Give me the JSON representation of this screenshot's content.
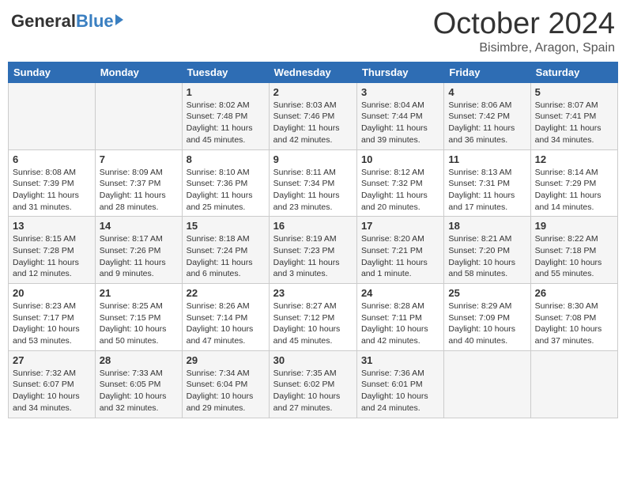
{
  "header": {
    "logo_general": "General",
    "logo_blue": "Blue",
    "title": "October 2024",
    "subtitle": "Bisimbre, Aragon, Spain"
  },
  "weekdays": [
    "Sunday",
    "Monday",
    "Tuesday",
    "Wednesday",
    "Thursday",
    "Friday",
    "Saturday"
  ],
  "weeks": [
    [
      {
        "day": "",
        "sunrise": "",
        "sunset": "",
        "daylight": ""
      },
      {
        "day": "",
        "sunrise": "",
        "sunset": "",
        "daylight": ""
      },
      {
        "day": "1",
        "sunrise": "Sunrise: 8:02 AM",
        "sunset": "Sunset: 7:48 PM",
        "daylight": "Daylight: 11 hours and 45 minutes."
      },
      {
        "day": "2",
        "sunrise": "Sunrise: 8:03 AM",
        "sunset": "Sunset: 7:46 PM",
        "daylight": "Daylight: 11 hours and 42 minutes."
      },
      {
        "day": "3",
        "sunrise": "Sunrise: 8:04 AM",
        "sunset": "Sunset: 7:44 PM",
        "daylight": "Daylight: 11 hours and 39 minutes."
      },
      {
        "day": "4",
        "sunrise": "Sunrise: 8:06 AM",
        "sunset": "Sunset: 7:42 PM",
        "daylight": "Daylight: 11 hours and 36 minutes."
      },
      {
        "day": "5",
        "sunrise": "Sunrise: 8:07 AM",
        "sunset": "Sunset: 7:41 PM",
        "daylight": "Daylight: 11 hours and 34 minutes."
      }
    ],
    [
      {
        "day": "6",
        "sunrise": "Sunrise: 8:08 AM",
        "sunset": "Sunset: 7:39 PM",
        "daylight": "Daylight: 11 hours and 31 minutes."
      },
      {
        "day": "7",
        "sunrise": "Sunrise: 8:09 AM",
        "sunset": "Sunset: 7:37 PM",
        "daylight": "Daylight: 11 hours and 28 minutes."
      },
      {
        "day": "8",
        "sunrise": "Sunrise: 8:10 AM",
        "sunset": "Sunset: 7:36 PM",
        "daylight": "Daylight: 11 hours and 25 minutes."
      },
      {
        "day": "9",
        "sunrise": "Sunrise: 8:11 AM",
        "sunset": "Sunset: 7:34 PM",
        "daylight": "Daylight: 11 hours and 23 minutes."
      },
      {
        "day": "10",
        "sunrise": "Sunrise: 8:12 AM",
        "sunset": "Sunset: 7:32 PM",
        "daylight": "Daylight: 11 hours and 20 minutes."
      },
      {
        "day": "11",
        "sunrise": "Sunrise: 8:13 AM",
        "sunset": "Sunset: 7:31 PM",
        "daylight": "Daylight: 11 hours and 17 minutes."
      },
      {
        "day": "12",
        "sunrise": "Sunrise: 8:14 AM",
        "sunset": "Sunset: 7:29 PM",
        "daylight": "Daylight: 11 hours and 14 minutes."
      }
    ],
    [
      {
        "day": "13",
        "sunrise": "Sunrise: 8:15 AM",
        "sunset": "Sunset: 7:28 PM",
        "daylight": "Daylight: 11 hours and 12 minutes."
      },
      {
        "day": "14",
        "sunrise": "Sunrise: 8:17 AM",
        "sunset": "Sunset: 7:26 PM",
        "daylight": "Daylight: 11 hours and 9 minutes."
      },
      {
        "day": "15",
        "sunrise": "Sunrise: 8:18 AM",
        "sunset": "Sunset: 7:24 PM",
        "daylight": "Daylight: 11 hours and 6 minutes."
      },
      {
        "day": "16",
        "sunrise": "Sunrise: 8:19 AM",
        "sunset": "Sunset: 7:23 PM",
        "daylight": "Daylight: 11 hours and 3 minutes."
      },
      {
        "day": "17",
        "sunrise": "Sunrise: 8:20 AM",
        "sunset": "Sunset: 7:21 PM",
        "daylight": "Daylight: 11 hours and 1 minute."
      },
      {
        "day": "18",
        "sunrise": "Sunrise: 8:21 AM",
        "sunset": "Sunset: 7:20 PM",
        "daylight": "Daylight: 10 hours and 58 minutes."
      },
      {
        "day": "19",
        "sunrise": "Sunrise: 8:22 AM",
        "sunset": "Sunset: 7:18 PM",
        "daylight": "Daylight: 10 hours and 55 minutes."
      }
    ],
    [
      {
        "day": "20",
        "sunrise": "Sunrise: 8:23 AM",
        "sunset": "Sunset: 7:17 PM",
        "daylight": "Daylight: 10 hours and 53 minutes."
      },
      {
        "day": "21",
        "sunrise": "Sunrise: 8:25 AM",
        "sunset": "Sunset: 7:15 PM",
        "daylight": "Daylight: 10 hours and 50 minutes."
      },
      {
        "day": "22",
        "sunrise": "Sunrise: 8:26 AM",
        "sunset": "Sunset: 7:14 PM",
        "daylight": "Daylight: 10 hours and 47 minutes."
      },
      {
        "day": "23",
        "sunrise": "Sunrise: 8:27 AM",
        "sunset": "Sunset: 7:12 PM",
        "daylight": "Daylight: 10 hours and 45 minutes."
      },
      {
        "day": "24",
        "sunrise": "Sunrise: 8:28 AM",
        "sunset": "Sunset: 7:11 PM",
        "daylight": "Daylight: 10 hours and 42 minutes."
      },
      {
        "day": "25",
        "sunrise": "Sunrise: 8:29 AM",
        "sunset": "Sunset: 7:09 PM",
        "daylight": "Daylight: 10 hours and 40 minutes."
      },
      {
        "day": "26",
        "sunrise": "Sunrise: 8:30 AM",
        "sunset": "Sunset: 7:08 PM",
        "daylight": "Daylight: 10 hours and 37 minutes."
      }
    ],
    [
      {
        "day": "27",
        "sunrise": "Sunrise: 7:32 AM",
        "sunset": "Sunset: 6:07 PM",
        "daylight": "Daylight: 10 hours and 34 minutes."
      },
      {
        "day": "28",
        "sunrise": "Sunrise: 7:33 AM",
        "sunset": "Sunset: 6:05 PM",
        "daylight": "Daylight: 10 hours and 32 minutes."
      },
      {
        "day": "29",
        "sunrise": "Sunrise: 7:34 AM",
        "sunset": "Sunset: 6:04 PM",
        "daylight": "Daylight: 10 hours and 29 minutes."
      },
      {
        "day": "30",
        "sunrise": "Sunrise: 7:35 AM",
        "sunset": "Sunset: 6:02 PM",
        "daylight": "Daylight: 10 hours and 27 minutes."
      },
      {
        "day": "31",
        "sunrise": "Sunrise: 7:36 AM",
        "sunset": "Sunset: 6:01 PM",
        "daylight": "Daylight: 10 hours and 24 minutes."
      },
      {
        "day": "",
        "sunrise": "",
        "sunset": "",
        "daylight": ""
      },
      {
        "day": "",
        "sunrise": "",
        "sunset": "",
        "daylight": ""
      }
    ]
  ]
}
